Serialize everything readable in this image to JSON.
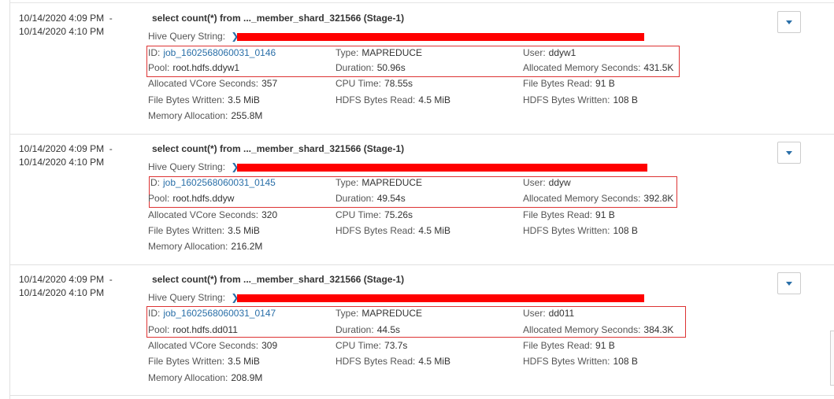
{
  "queries": [
    {
      "start": "10/14/2020 4:09 PM  -",
      "end": "10/14/2020 4:10 PM",
      "statement": "select count(*) from ..._member_shard_321566 (Stage-1)",
      "hive_label": "Hive Query String:",
      "id_label": "ID:",
      "id": "job_1602568060031_0146",
      "type_label": "Type:",
      "type": "MAPREDUCE",
      "user_label": "User:",
      "user": "ddyw1",
      "pool_label": "Pool:",
      "pool": "root.hdfs.ddyw1",
      "duration_label": "Duration:",
      "duration": "50.96s",
      "ams_label": "Allocated Memory Seconds:",
      "ams": "431.5K",
      "avs_label": "Allocated VCore Seconds:",
      "avs": "357",
      "cpu_label": "CPU Time:",
      "cpu": "78.55s",
      "fbr_label": "File Bytes Read:",
      "fbr": "91 B",
      "fbw_label": "File Bytes Written:",
      "fbw": "3.5 MiB",
      "hbr_label": "HDFS Bytes Read:",
      "hbr": "4.5 MiB",
      "hbw_label": "HDFS Bytes Written:",
      "hbw": "108 B",
      "mem_label": "Memory Allocation:",
      "mem": "255.8M"
    },
    {
      "start": "10/14/2020 4:09 PM  -",
      "end": "10/14/2020 4:10 PM",
      "statement": "select count(*) from ..._member_shard_321566 (Stage-1)",
      "hive_label": "Hive Query String:",
      "id_label": "D:",
      "id": "job_1602568060031_0145",
      "type_label": "Type:",
      "type": "MAPREDUCE",
      "user_label": "User:",
      "user": "ddyw",
      "pool_label": "Pool:",
      "pool": "root.hdfs.ddyw",
      "duration_label": "Duration:",
      "duration": "49.54s",
      "ams_label": "Allocated Memory Seconds:",
      "ams": "392.8K",
      "avs_label": "Allocated VCore Seconds:",
      "avs": "320",
      "cpu_label": "CPU Time:",
      "cpu": "75.26s",
      "fbr_label": "File Bytes Read:",
      "fbr": "91 B",
      "fbw_label": "File Bytes Written:",
      "fbw": "3.5 MiB",
      "hbr_label": "HDFS Bytes Read:",
      "hbr": "4.5 MiB",
      "hbw_label": "HDFS Bytes Written:",
      "hbw": "108 B",
      "mem_label": "Memory Allocation:",
      "mem": "216.2M"
    },
    {
      "start": "10/14/2020 4:09 PM  -",
      "end": "10/14/2020 4:10 PM",
      "statement": "select count(*) from ..._member_shard_321566 (Stage-1)",
      "hive_label": "Hive Query String:",
      "id_label": "ID:",
      "id": "job_1602568060031_0147",
      "type_label": "Type:",
      "type": "MAPREDUCE",
      "user_label": "User:",
      "user": "dd011",
      "pool_label": "Pool:",
      "pool": "root.hdfs.dd011",
      "duration_label": "Duration:",
      "duration": "44.5s",
      "ams_label": "Allocated Memory Seconds:",
      "ams": "384.3K",
      "avs_label": "Allocated VCore Seconds:",
      "avs": "309",
      "cpu_label": "CPU Time:",
      "cpu": "73.7s",
      "fbr_label": "File Bytes Read:",
      "fbr": "91 B",
      "fbw_label": "File Bytes Written:",
      "fbw": "3.5 MiB",
      "hbr_label": "HDFS Bytes Read:",
      "hbr": "4.5 MiB",
      "hbw_label": "HDFS Bytes Written:",
      "hbw": "108 B",
      "mem_label": "Memory Allocation:",
      "mem": "208.9M"
    }
  ],
  "colors": {
    "link": "#2a6fa8",
    "redaction": "#ff0000",
    "highlight_box": "#dd3333"
  },
  "icons": {
    "expand": "chevron-right-icon",
    "menu": "caret-down-icon"
  }
}
